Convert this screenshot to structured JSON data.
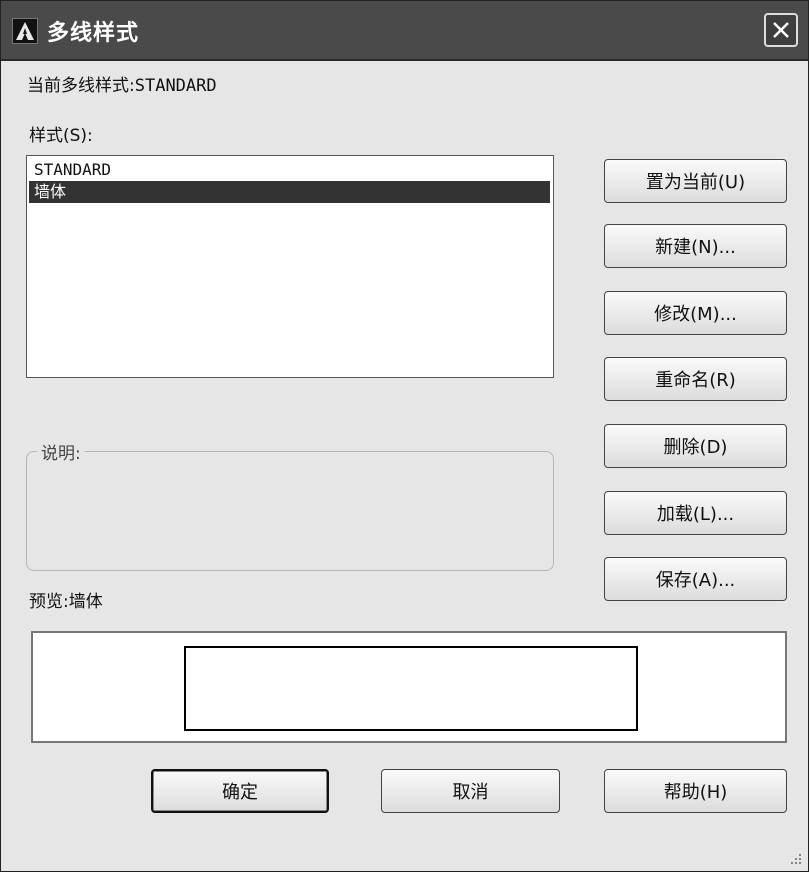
{
  "window": {
    "title": "多线样式",
    "close_symbol": "✕"
  },
  "current_style": {
    "label": "当前多线样式:",
    "value": "STANDARD"
  },
  "styles": {
    "label": "样式(S):",
    "items": [
      {
        "name": "STANDARD",
        "selected": false
      },
      {
        "name": "墙体",
        "selected": true
      }
    ]
  },
  "description": {
    "label": "说明:",
    "value": ""
  },
  "preview": {
    "label": "预览:",
    "value": "墙体"
  },
  "buttons": {
    "set_current": "置为当前(U)",
    "new": "新建(N)...",
    "modify": "修改(M)...",
    "rename": "重命名(R)",
    "delete": "删除(D)",
    "load": "加载(L)...",
    "save": "保存(A)...",
    "ok": "确定",
    "cancel": "取消",
    "help": "帮助(H)"
  },
  "icons": {
    "app": "autocad-logo-icon",
    "close": "close-icon",
    "resize": "resize-grip-icon"
  }
}
